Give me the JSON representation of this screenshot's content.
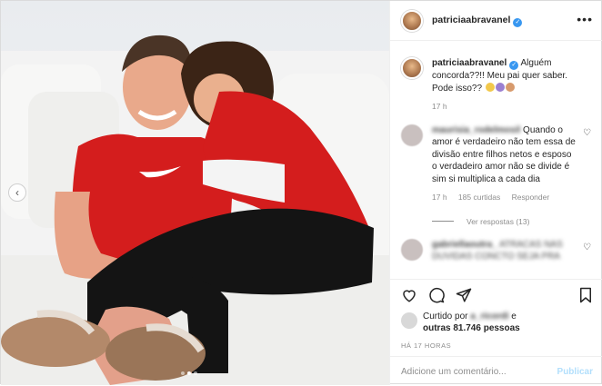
{
  "post": {
    "username": "patriciaabravanel",
    "verified_icon": "verified-badge-icon",
    "caption": "Alguém concorda??!! Meu pai quer saber. Pode isso??",
    "caption_time": "17 h",
    "more_icon": "•••"
  },
  "comments": [
    {
      "username": "maurisia_rodelmosil",
      "text": "Quando o amor é verdadeiro não tem essa de divisão entre filhos netos e esposo o verdadeiro amor não se divide é sim si multiplica a cada dia",
      "time": "17 h",
      "likes": "185 curtidas",
      "reply": "Responder",
      "view_replies": "Ver respostas (13)"
    },
    {
      "username": "gabriellaoutra_",
      "text": "ATRACAS NAS DUVIDAS CONCTO SEJA PRA"
    }
  ],
  "actions": {
    "liked_prefix": "Curtido por",
    "liked_user": "a_ricordi",
    "liked_and": "e",
    "liked_others": "outras 81.746 pessoas",
    "timestamp": "HÁ 17 HORAS",
    "comment_placeholder": "Adicione um comentário...",
    "publish_label": "Publicar"
  },
  "carousel": {
    "slides": 3,
    "active_index": 1
  },
  "colors": {
    "accent": "#3897f0",
    "publish_disabled": "#b2dffc",
    "muted": "#8e8e8e",
    "shirt": "#d41d1d"
  }
}
